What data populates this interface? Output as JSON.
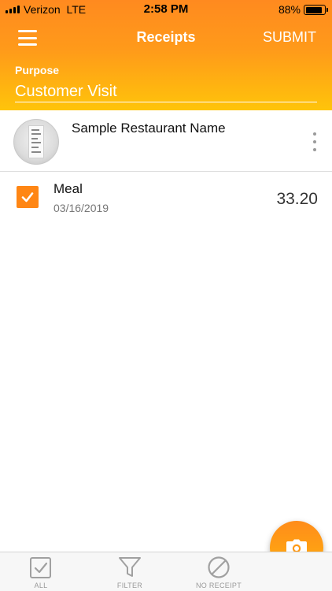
{
  "status_bar": {
    "carrier": "Verizon",
    "network": "LTE",
    "time": "2:58 PM",
    "battery_percent": "88%",
    "battery_level": 0.88
  },
  "header": {
    "title": "Receipts",
    "submit_label": "SUBMIT",
    "menu_icon": "hamburger-menu-icon"
  },
  "purpose": {
    "label": "Purpose",
    "value": "Customer Visit"
  },
  "receipt": {
    "merchant": "Sample Restaurant Name",
    "thumbnail_icon": "receipt-thumbnail",
    "more_icon": "vertical-dots-icon"
  },
  "expenses": [
    {
      "category": "Meal",
      "date": "03/16/2019",
      "amount": "33.20",
      "checked": true
    }
  ],
  "fab": {
    "icon": "camera-icon"
  },
  "bottom_tabs": [
    {
      "label": "ALL",
      "icon": "checkbox-icon"
    },
    {
      "label": "FILTER",
      "icon": "filter-funnel-icon"
    },
    {
      "label": "NO RECEIPT",
      "icon": "prohibited-icon"
    }
  ],
  "colors": {
    "accent_orange": "#ff8614",
    "header_top": "#ff8a1f",
    "header_bottom": "#ffc40a",
    "tab_gray": "#9a9a9a"
  }
}
